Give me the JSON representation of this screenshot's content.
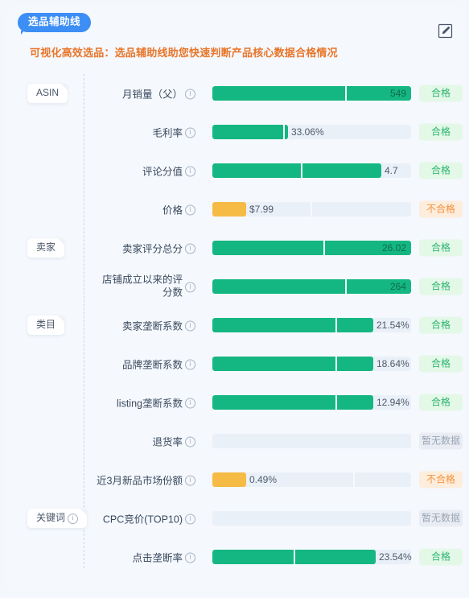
{
  "header": {
    "tab_label": "选品辅助线",
    "subtitle": "可视化高效选品：选品辅助线助您快速判断产品核心数据合格情况",
    "edit_icon": "edit-pencil-square-icon"
  },
  "colors": {
    "accent_blue": "#3d8ef5",
    "subtitle_orange": "#e8762a",
    "bar_green": "#14b781",
    "bar_orange": "#f5bb45",
    "track": "#eaf0f8",
    "badge_ok_bg": "#e4f8e8",
    "badge_ok_text": "#2cb56e",
    "badge_bad_bg": "#fdeddc",
    "badge_bad_text": "#f5913d",
    "badge_none_bg": "#e9edf3",
    "badge_none_text": "#9aa5b4"
  },
  "status_labels": {
    "ok": "合格",
    "bad": "不合格",
    "none": "暂无数据"
  },
  "groups": [
    {
      "label": "ASIN",
      "has_info": false
    },
    {
      "label": "卖家",
      "has_info": false
    },
    {
      "label": "类目",
      "has_info": false
    },
    {
      "label": "关键词",
      "has_info": true
    }
  ],
  "rows": [
    {
      "group": "ASIN",
      "metric": "月销量（父）",
      "has_info": true,
      "value_text": "549",
      "value_inside": true,
      "bar_color": "#14b781",
      "fill_pct": 100,
      "segments": [
        67
      ],
      "status": "ok",
      "status_text": "合格"
    },
    {
      "group": "",
      "metric": "毛利率",
      "has_info": true,
      "value_text": "33.06%",
      "value_inside": false,
      "bar_color": "#14b781",
      "fill_pct": 38,
      "segments": [
        35.5
      ],
      "status": "ok",
      "status_text": "合格"
    },
    {
      "group": "",
      "metric": "评论分值",
      "has_info": true,
      "value_text": "4.7",
      "value_inside": false,
      "bar_color": "#14b781",
      "fill_pct": 85,
      "segments": [
        44.5
      ],
      "status": "ok",
      "status_text": "合格"
    },
    {
      "group": "",
      "metric": "价格",
      "has_info": true,
      "value_text": "$7.99",
      "value_inside": false,
      "bar_color": "#f5bb45",
      "fill_pct": 17,
      "segments": [
        49.5
      ],
      "status": "bad",
      "status_text": "不合格"
    },
    {
      "group": "卖家",
      "metric": "卖家评分总分",
      "has_info": true,
      "value_text": "26.02",
      "value_inside": true,
      "bar_color": "#14b781",
      "fill_pct": 100,
      "segments": [
        56
      ],
      "status": "ok",
      "status_text": "合格"
    },
    {
      "group": "",
      "metric": "店铺成立以来的评分数",
      "has_info": true,
      "two_line": true,
      "value_text": "264",
      "value_inside": true,
      "bar_color": "#14b781",
      "fill_pct": 100,
      "segments": [
        67
      ],
      "status": "ok",
      "status_text": "合格"
    },
    {
      "group": "类目",
      "metric": "卖家垄断系数",
      "has_info": true,
      "value_text": "21.54%",
      "value_inside": false,
      "bar_color": "#14b781",
      "fill_pct": 81,
      "segments": [
        62
      ],
      "status": "ok",
      "status_text": "合格"
    },
    {
      "group": "",
      "metric": "品牌垄断系数",
      "has_info": true,
      "value_text": "18.64%",
      "value_inside": false,
      "bar_color": "#14b781",
      "fill_pct": 81,
      "segments": [
        62
      ],
      "status": "ok",
      "status_text": "合格"
    },
    {
      "group": "",
      "metric": "listing垄断系数",
      "has_info": true,
      "value_text": "12.94%",
      "value_inside": false,
      "bar_color": "#14b781",
      "fill_pct": 81,
      "segments": [
        62
      ],
      "status": "ok",
      "status_text": "合格"
    },
    {
      "group": "",
      "metric": "退货率",
      "has_info": true,
      "value_text": "",
      "value_inside": false,
      "bar_color": "#14b781",
      "fill_pct": 0,
      "segments": [],
      "status": "none",
      "status_text": "暂无数据"
    },
    {
      "group": "",
      "metric": "近3月新品市场份额",
      "has_info": true,
      "value_text": "0.49%",
      "value_inside": false,
      "bar_color": "#f5bb45",
      "fill_pct": 17,
      "segments": [
        71
      ],
      "status": "bad",
      "status_text": "不合格"
    },
    {
      "group": "关键词",
      "group_info": true,
      "metric": "CPC竞价(TOP10)",
      "has_info": true,
      "value_text": "",
      "value_inside": false,
      "bar_color": "#14b781",
      "fill_pct": 0,
      "segments": [],
      "status": "none",
      "status_text": "暂无数据"
    },
    {
      "group": "",
      "metric": "点击垄断率",
      "has_info": true,
      "value_text": "23.54%",
      "value_inside": false,
      "bar_color": "#14b781",
      "fill_pct": 82,
      "segments": [
        41
      ],
      "status": "ok",
      "status_text": "合格"
    }
  ],
  "chart_data": {
    "type": "bar",
    "title": "选品辅助线",
    "orientation": "horizontal",
    "categories": [
      "月销量（父）",
      "毛利率",
      "评论分值",
      "价格",
      "卖家评分总分",
      "店铺成立以来的评分数",
      "卖家垄断系数",
      "品牌垄断系数",
      "listing垄断系数",
      "退货率",
      "近3月新品市场份额",
      "CPC竞价(TOP10)",
      "点击垄断率"
    ],
    "values": [
      549,
      33.06,
      4.7,
      7.99,
      26.02,
      264,
      21.54,
      18.64,
      12.94,
      null,
      0.49,
      null,
      23.54
    ],
    "value_labels": [
      "549",
      "33.06%",
      "4.7",
      "$7.99",
      "26.02",
      "264",
      "21.54%",
      "18.64%",
      "12.94%",
      "",
      "0.49%",
      "",
      "23.54%"
    ],
    "fill_pct": [
      100,
      38,
      85,
      17,
      100,
      100,
      81,
      81,
      81,
      0,
      17,
      0,
      82
    ],
    "statuses": [
      "合格",
      "合格",
      "合格",
      "不合格",
      "合格",
      "合格",
      "合格",
      "合格",
      "合格",
      "暂无数据",
      "不合格",
      "暂无数据",
      "合格"
    ],
    "groups": [
      "ASIN",
      "ASIN",
      "ASIN",
      "ASIN",
      "卖家",
      "卖家",
      "类目",
      "类目",
      "类目",
      "类目",
      "类目",
      "关键词",
      "关键词"
    ],
    "grid": false,
    "legend": "none"
  }
}
